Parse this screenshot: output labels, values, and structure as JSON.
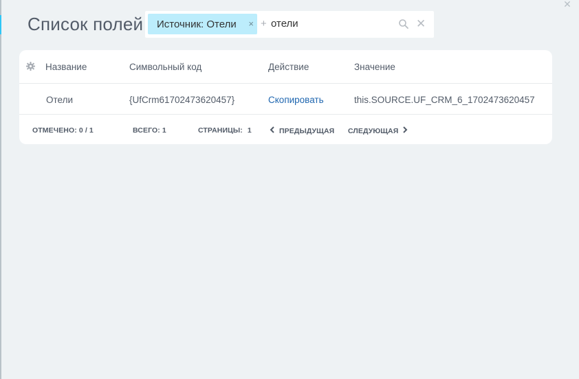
{
  "header": {
    "title": "Список полей",
    "close_symbol": "✕"
  },
  "search": {
    "filter_tag_label": "Источник: Отели",
    "filter_tag_remove": "×",
    "plus": "+",
    "query": "отели",
    "search_icon": "search-icon",
    "clear_symbol": "✕"
  },
  "grid": {
    "columns": [
      "Название",
      "Символьный код",
      "Действие",
      "Значение"
    ],
    "rows": [
      {
        "name": "Отели",
        "code": "{UfCrm61702473620457}",
        "action": "Скопировать",
        "value": "this.SOURCE.UF_CRM_6_1702473620457"
      }
    ],
    "footer": {
      "checked_label": "ОТМЕЧЕНО:",
      "checked_value": "0 / 1",
      "total_label": "ВСЕГО:",
      "total_value": "1",
      "pages_label": "СТРАНИЦЫ:",
      "pages_value": "1",
      "prev_label": "ПРЕДЫДУЩАЯ",
      "next_label": "СЛЕДУЮЩАЯ"
    }
  },
  "colors": {
    "background": "#eef2f4",
    "tag": "#bcedfc",
    "link": "#2067b0",
    "accent": "#2fc6f6"
  }
}
